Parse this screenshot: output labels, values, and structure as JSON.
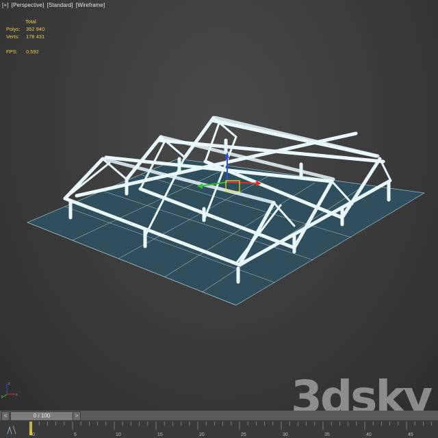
{
  "viewport": {
    "labels": [
      "[+]",
      "[Perspective]",
      "[Standard]",
      "[Wireframe]"
    ]
  },
  "stats": {
    "header": "Total",
    "polys_label": "Polys:",
    "polys_value": "352 940",
    "verts_label": "Verts:",
    "verts_value": "178 431",
    "fps_label": "FPS:",
    "fps_value": "0,592"
  },
  "colors": {
    "ground": "#2f4f5c",
    "grid": "#bcd0d8",
    "structure": "#e8f8fb",
    "axis_x": "#e03030",
    "axis_y": "#30c030",
    "axis_z": "#3050e0",
    "gizmo_yellow": "#f0e020"
  },
  "timeline": {
    "frame_display": "0 / 100",
    "prev_label": "<",
    "next_label": ">",
    "ticks": [
      "0",
      "5",
      "10",
      "15",
      "20",
      "25",
      "30",
      "35",
      "40",
      "45"
    ]
  },
  "axis_tripod": {
    "x": "x",
    "y": "y",
    "z": "z"
  },
  "watermark": "3dsky"
}
